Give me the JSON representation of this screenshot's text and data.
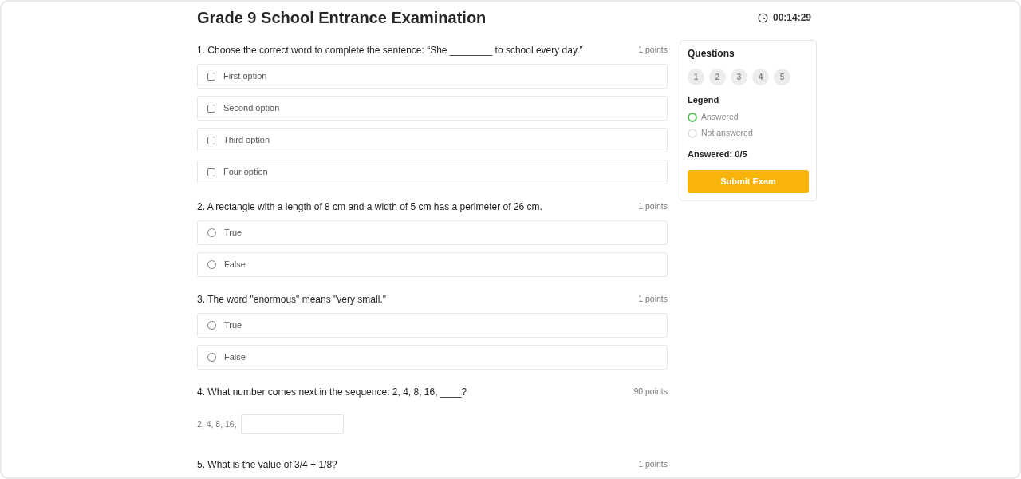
{
  "header": {
    "title": "Grade 9 School Entrance Examination",
    "timer": "00:14:29"
  },
  "questions": [
    {
      "text": "1. Choose the correct word to complete the sentence: “She ________ to school every day.”",
      "points": "1 points",
      "answer": {
        "kind": "checkbox",
        "options": [
          {
            "label": "First option",
            "checked": false
          },
          {
            "label": "Second option",
            "checked": false
          },
          {
            "label": "Third option",
            "checked": false
          },
          {
            "label": "Four option",
            "checked": false
          }
        ]
      }
    },
    {
      "text": "2. A rectangle with a length of 8 cm and a width of 5 cm has a perimeter of 26 cm.",
      "points": "1 points",
      "answer": {
        "kind": "radio",
        "options": [
          {
            "label": "True",
            "selected": false
          },
          {
            "label": "False",
            "selected": false
          }
        ]
      }
    },
    {
      "text": "3. The word \"enormous\" means \"very small.\"",
      "points": "1 points",
      "answer": {
        "kind": "radio",
        "options": [
          {
            "label": "True",
            "selected": false
          },
          {
            "label": "False",
            "selected": false
          }
        ]
      }
    },
    {
      "text": "4. What number comes next in the sequence: 2, 4, 8, 16, ____?",
      "points": "90 points",
      "answer": {
        "kind": "fill_in",
        "prefix": "2, 4, 8, 16,"
      }
    },
    {
      "text": "5. What is the value of 3/4 + 1/8?",
      "points": "1 points"
    }
  ],
  "sidebar": {
    "title": "Questions",
    "question_buttons": [
      {
        "label": "1",
        "answered": false
      },
      {
        "label": "2",
        "answered": false
      },
      {
        "label": "3",
        "answered": false
      },
      {
        "label": "4",
        "answered": false
      },
      {
        "label": "5",
        "answered": false
      }
    ],
    "legend_title": "Legend",
    "legend": [
      {
        "label": "Answered",
        "color": "#5ec05e"
      },
      {
        "label": "Not answered",
        "color": "#e2e2e2"
      }
    ],
    "answered_count": "Answered: 0/5",
    "submit_button": "Submit Exam"
  }
}
